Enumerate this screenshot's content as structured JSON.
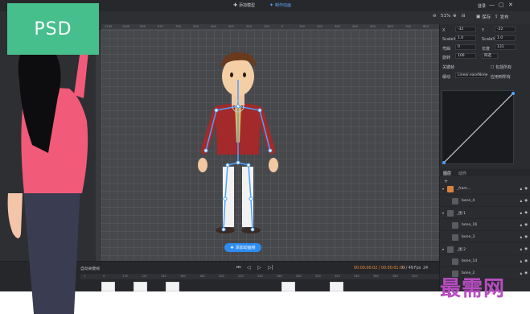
{
  "titlebar": {
    "add_model": "添加模型",
    "make_anim": "制作动画",
    "login": "登录",
    "min": "—",
    "max": "▢",
    "close": "✕"
  },
  "toolbar": {
    "zoom": "51%",
    "save": "保存",
    "publish": "发布"
  },
  "ruler_marks": [
    "1100",
    "1000",
    "900",
    "875",
    "750",
    "500",
    "400",
    "300",
    "200",
    "100",
    "0",
    "100",
    "200",
    "300",
    "400",
    "500",
    "600",
    "700",
    "800"
  ],
  "props": {
    "x_label": "X",
    "x_val": "-32",
    "y_label": "Y",
    "y_val": "-22",
    "scalex_label": "ScaleX",
    "scalex_val": "1.0",
    "scaley_label": "ScaleY",
    "scaley_val": "1.0",
    "weight_label": "弯曲",
    "weight_val": "0",
    "length_label": "长度",
    "length_val": "131",
    "rotation_label": "旋转",
    "rotation_val": "106",
    "slot_label": "四选",
    "state_label": "关键帧",
    "check_label": "包括所有",
    "ease_label": "缓动",
    "ease_val": "Linear.easeNone",
    "apply_label": "应用到所有"
  },
  "tabs": {
    "layers": "图层",
    "anim": "动作"
  },
  "layers": [
    {
      "name": "_from...",
      "thumb": true
    },
    {
      "name": "bone_4"
    },
    {
      "name": "_图 1"
    },
    {
      "name": "bone_16"
    },
    {
      "name": "bone_3"
    },
    {
      "name": "_图 2"
    },
    {
      "name": "bone_14"
    },
    {
      "name": "bone_2"
    }
  ],
  "canvas": {
    "add_anim_button": "添加动画帧"
  },
  "timeline": {
    "auto_key": "自动关键帧",
    "time": "00:00:00:02 / 00:00:01:00",
    "frame": "0 / 49",
    "fps_label": "Fps",
    "fps_val": "24",
    "marks": [
      "1",
      "9",
      "119",
      "120",
      "140",
      "160",
      "180",
      "200",
      "220",
      "240",
      "260",
      "280",
      "300",
      "320",
      "340",
      "360",
      "380",
      "400"
    ]
  },
  "overlay": {
    "psd_badge": "PSD",
    "watermark": "最需网"
  }
}
